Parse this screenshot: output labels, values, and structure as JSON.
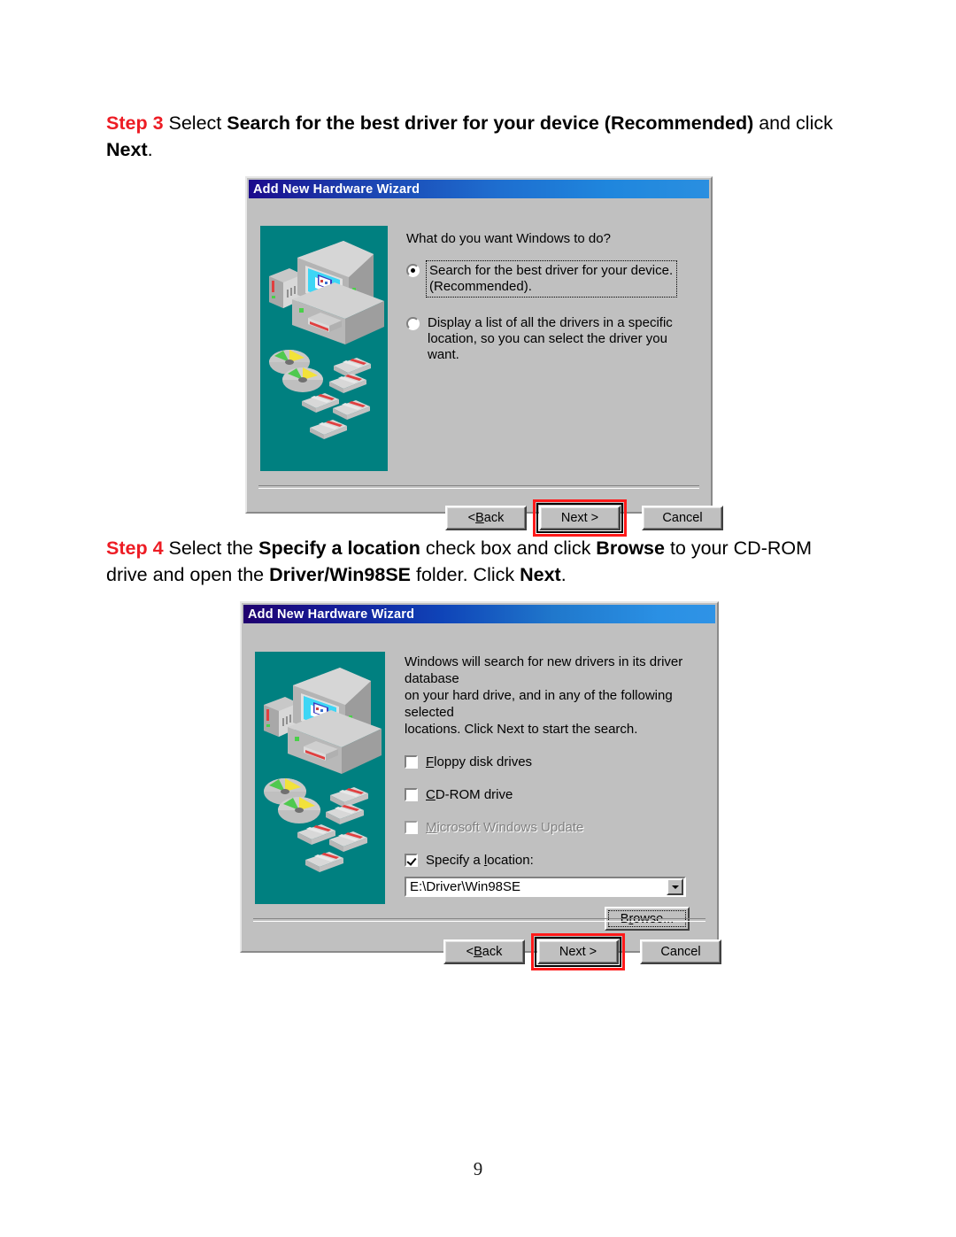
{
  "page": {
    "number": "9",
    "accent_red": "#ed1c24",
    "dialog_face": "#c0c0c0",
    "illustration_bg": "#008080"
  },
  "steps": [
    {
      "label": "Step 3",
      "text_parts": [
        {
          "t": " Select ",
          "bold": false
        },
        {
          "t": "Search for the best driver for your device (Recommended)",
          "bold": true
        },
        {
          "t": " and click ",
          "bold": false
        },
        {
          "t": "Next",
          "bold": true
        },
        {
          "t": ".",
          "bold": false
        }
      ]
    },
    {
      "label": "Step 4",
      "text_parts": [
        {
          "t": " Select the ",
          "bold": false
        },
        {
          "t": "Specify a location",
          "bold": true
        },
        {
          "t": " check box and click ",
          "bold": false
        },
        {
          "t": "Browse",
          "bold": true
        },
        {
          "t": " to your CD-ROM drive and open the ",
          "bold": false
        },
        {
          "t": "Driver/Win98SE",
          "bold": true
        },
        {
          "t": " folder. Click ",
          "bold": false
        },
        {
          "t": "Next",
          "bold": true
        },
        {
          "t": ".",
          "bold": false
        }
      ]
    }
  ],
  "dialog_step3": {
    "title": "Add New Hardware Wizard",
    "prompt": "What do you want Windows to do?",
    "options": [
      {
        "line1": "Search for the best driver for your device.",
        "line2": "(Recommended).",
        "selected": true,
        "focused": true
      },
      {
        "line1": "Display a list of all the drivers in a specific",
        "line2": "location, so you can select the driver you want.",
        "selected": false,
        "focused": false
      }
    ],
    "buttons": {
      "back": "< Back",
      "next": "Next >",
      "cancel": "Cancel",
      "next_is_default": true,
      "next_highlighted": true
    }
  },
  "dialog_step4": {
    "title": "Add New Hardware Wizard",
    "prompt_line1": "Windows will search for new drivers in its driver database",
    "prompt_line2": "on your hard drive, and in any of the following selected",
    "prompt_line3": "locations. Click Next to start the search.",
    "checkboxes": [
      {
        "label": "Floppy disk drives",
        "accel": "F",
        "checked": false,
        "disabled": false
      },
      {
        "label": "CD-ROM drive",
        "accel": "C",
        "checked": false,
        "disabled": false
      },
      {
        "label": "Microsoft Windows Update",
        "accel": "M",
        "checked": false,
        "disabled": true
      },
      {
        "label": "Specify a location:",
        "accel": "l",
        "checked": true,
        "disabled": false
      }
    ],
    "location_value": "E:\\Driver\\Win98SE",
    "browse_label": "Browse...",
    "buttons": {
      "back": "< Back",
      "next": "Next >",
      "cancel": "Cancel",
      "next_is_default": true,
      "next_highlighted": true
    }
  }
}
